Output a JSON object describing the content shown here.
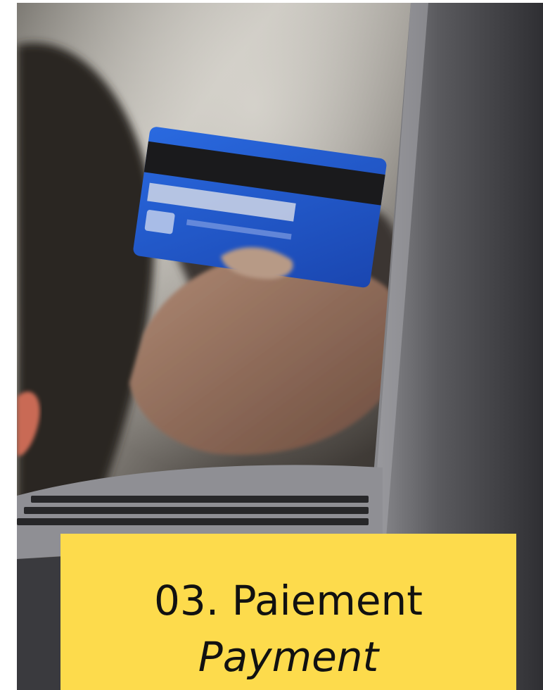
{
  "image": {
    "description": "Hand holding a blue credit card above a laptop keyboard",
    "colors": {
      "card_blue": "#1f56c7",
      "background": "#2e2a26",
      "laptop_gray": "#58585c"
    }
  },
  "caption": {
    "french": "03. Paiement",
    "english": "Payment",
    "background_color": "#fddb4c",
    "text_color": "#111111"
  }
}
